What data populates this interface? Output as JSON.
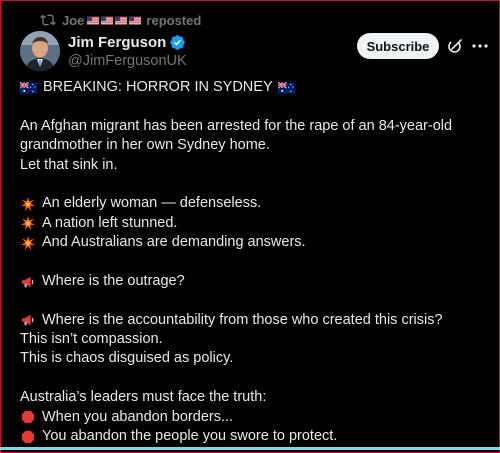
{
  "repost": {
    "name": "Joe",
    "label": "reposted",
    "flags": [
      "us-flag",
      "us-flag",
      "us-flag",
      "us-flag"
    ]
  },
  "author": {
    "display_name": "Jim Ferguson",
    "handle": "@JimFergusonUK",
    "verified_icon": "verified-badge-icon"
  },
  "actions": {
    "subscribe_label": "Subscribe",
    "grok_icon": "grok-icon",
    "more_icon": "more-icon"
  },
  "post": {
    "headline": "BREAKING: HORROR IN SYDNEY",
    "p1": [
      "An Afghan migrant has been arrested for the rape of an 84-year-old",
      "grandmother in her own Sydney home.",
      "Let that sink in."
    ],
    "bullets": [
      "An elderly woman — defenseless.",
      "A nation left stunned.",
      "And Australians are demanding answers."
    ],
    "outrage": "Where is the outrage?",
    "accountability": "Where is the accountability from those who created this crisis?",
    "p3": [
      "This isn’t compassion.",
      "This is chaos disguised as policy."
    ],
    "leaders": "Australia’s leaders must face the truth:",
    "stop_lines": [
      "When you abandon borders...",
      "You abandon the people you swore to protect."
    ]
  },
  "colors": {
    "background": "#000000",
    "text": "#e7e9ea",
    "muted": "#71767b",
    "verified": "#1d9bf0",
    "subscribe_bg": "#eff3f4"
  }
}
